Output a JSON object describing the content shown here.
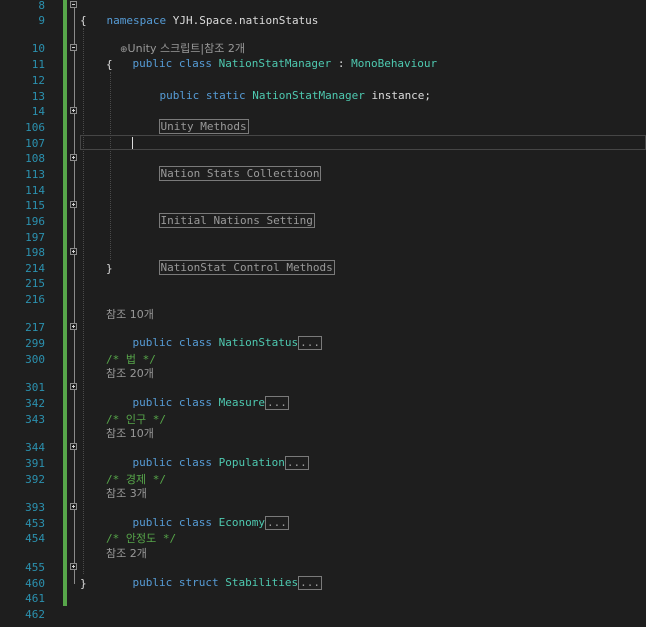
{
  "editor": {
    "line_numbers": {
      "l8": "8",
      "l9": "9",
      "l10": "10",
      "l11": "11",
      "l12": "12",
      "l13": "13",
      "l14": "14",
      "l106": "106",
      "l107": "107",
      "l108": "108",
      "l113": "113",
      "l114": "114",
      "l115": "115",
      "l196": "196",
      "l197": "197",
      "l198": "198",
      "l214": "214",
      "l215": "215",
      "l216": "216",
      "l217": "217",
      "l299": "299",
      "l300": "300",
      "l301": "301",
      "l342": "342",
      "l343": "343",
      "l344": "344",
      "l391": "391",
      "l392": "392",
      "l393": "393",
      "l453": "453",
      "l454": "454",
      "l455": "455",
      "l460": "460",
      "l461": "461",
      "l462": "462"
    },
    "namespace_line": {
      "keyword": "namespace",
      "name": " YJH.Space.nationStatus"
    },
    "brace_open_ns": "{",
    "brace_close_ns": "}",
    "class_manager": {
      "codelens_icon": "⊕",
      "codelens": "Unity 스크립트|참조 2개",
      "kw_public": "public",
      "kw_class": " class ",
      "name": "NationStatManager",
      "colon": " : ",
      "base": "MonoBehaviour",
      "brace_open": "{",
      "brace_close": "}",
      "instance_line": {
        "kw_public": "public",
        "kw_static": " static ",
        "type": "NationStatManager",
        "rest": " instance;"
      },
      "regions": {
        "unity_methods": "Unity Methods",
        "collection": "Nation Stats Collectioon",
        "initial": "Initial Nations Setting",
        "control": "NationStat Control Methods"
      }
    },
    "nation_status": {
      "codelens": "참조 10개",
      "kw_public": "public",
      "kw_class": " class ",
      "name": "NationStatus",
      "ellipsis": "..."
    },
    "measure": {
      "comment": "/* 법 */",
      "codelens": "참조 20개",
      "kw_public": "public",
      "kw_class": " class ",
      "name": "Measure",
      "ellipsis": "..."
    },
    "population": {
      "comment": "/* 인구 */",
      "codelens": "참조 10개",
      "kw_public": "public",
      "kw_class": " class ",
      "name": "Population",
      "ellipsis": "..."
    },
    "economy": {
      "comment": "/* 경제 */",
      "codelens": "참조 3개",
      "kw_public": "public",
      "kw_class": " class ",
      "name": "Economy",
      "ellipsis": "..."
    },
    "stabilities": {
      "comment": "/* 안정도 */",
      "codelens": "참조 2개",
      "kw_public": "public",
      "kw_struct": " struct ",
      "name": "Stabilities",
      "ellipsis": "..."
    }
  },
  "colors": {
    "background": "#1e1e1e",
    "line_number": "#2b91af",
    "keyword": "#569cd6",
    "type": "#4ec9b0",
    "comment": "#57a64a",
    "change_bar": "#57a64a",
    "text": "#dcdcdc"
  }
}
